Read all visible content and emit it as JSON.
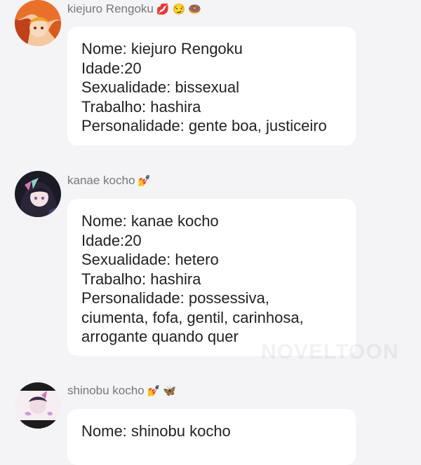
{
  "messages": [
    {
      "author": "kiejuro Rengoku",
      "author_emojis": [
        "💋",
        "😏",
        "🍩"
      ],
      "lines": [
        "Nome: kiejuro Rengoku",
        "Idade:20",
        "Sexualidade: bissexual",
        "Trabalho: hashira",
        "Personalidade: gente boa, justiceiro"
      ]
    },
    {
      "author": "kanae kocho",
      "author_emojis": [
        "💅"
      ],
      "lines": [
        "Nome: kanae kocho",
        "Idade:20",
        "Sexualidade: hetero",
        "Trabalho: hashira",
        "Personalidade: possessiva, ciumenta, fofa, gentil, carinhosa, arrogante quando quer"
      ]
    },
    {
      "author": "shinobu kocho",
      "author_emojis": [
        "💅",
        "🦋"
      ],
      "lines": [
        "Nome: shinobu kocho"
      ]
    }
  ],
  "watermark": "NOVELTOON",
  "colors": {
    "background": "#f4f4f6",
    "bubble": "#ffffff",
    "name_text": "#777777",
    "message_text": "#222222"
  }
}
